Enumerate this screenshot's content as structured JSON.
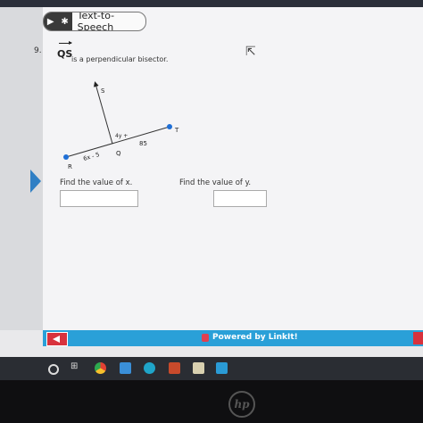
{
  "toolbar": {
    "tts_label": "Text-to-Speech"
  },
  "question": {
    "number": "9.",
    "ray_label": "QS",
    "statement": "is a perpendicular bisector."
  },
  "diagram": {
    "point_labels": {
      "S": "S",
      "T": "T",
      "Q": "Q",
      "R": "R"
    },
    "angle_label": "4y +",
    "segment_rq": "6x - 5",
    "segment_qt": "85"
  },
  "prompts": {
    "find_x": "Find the value of x.",
    "find_y": "Find the value of y."
  },
  "inputs": {
    "x_value": "",
    "y_value": ""
  },
  "footer": {
    "powered_by": "Powered by LinkIt!"
  },
  "colors": {
    "footer_bar": "#2aa0d8",
    "nav_button": "#d8323d",
    "tts_button": "#3a3a3a"
  },
  "icons": {
    "tts": [
      "play-icon",
      "gear-icon"
    ],
    "taskbar": [
      "circle-icon",
      "task-view-icon",
      "chrome-icon",
      "media-icon",
      "edge-icon",
      "store-icon",
      "photos-icon",
      "teams-icon"
    ]
  }
}
